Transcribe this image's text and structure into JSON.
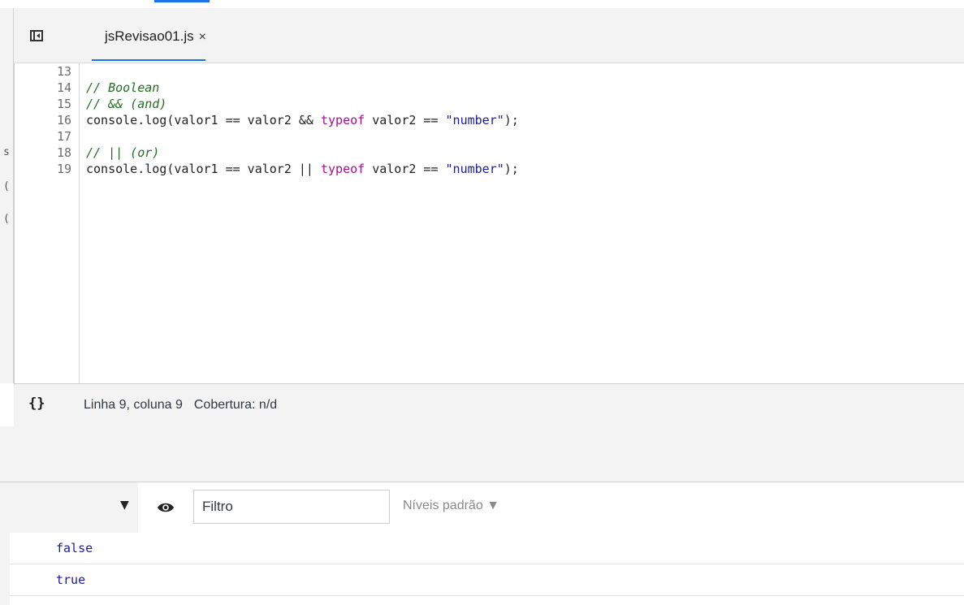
{
  "tab": {
    "filename": "jsRevisao01.js",
    "close_glyph": "×"
  },
  "editor": {
    "lines": [
      {
        "number": "13",
        "segments": []
      },
      {
        "number": "14",
        "segments": [
          {
            "type": "comment",
            "text": "// Boolean"
          }
        ]
      },
      {
        "number": "15",
        "segments": [
          {
            "type": "comment",
            "text": "// && (and)"
          }
        ]
      },
      {
        "number": "16",
        "segments": [
          {
            "type": "plain",
            "text": "console.log(valor1 == valor2 && "
          },
          {
            "type": "keyword",
            "text": "typeof"
          },
          {
            "type": "plain",
            "text": " valor2 == "
          },
          {
            "type": "string",
            "text": "\"number\""
          },
          {
            "type": "plain",
            "text": ");"
          }
        ]
      },
      {
        "number": "17",
        "segments": []
      },
      {
        "number": "18",
        "segments": [
          {
            "type": "comment",
            "text": "// || (or)"
          }
        ]
      },
      {
        "number": "19",
        "segments": [
          {
            "type": "plain",
            "text": "console.log(valor1 == valor2 || "
          },
          {
            "type": "keyword",
            "text": "typeof"
          },
          {
            "type": "plain",
            "text": " valor2 == "
          },
          {
            "type": "string",
            "text": "\"number\""
          },
          {
            "type": "plain",
            "text": ");"
          }
        ]
      }
    ]
  },
  "left_edge_fragments": [
    "s",
    "(",
    "("
  ],
  "status": {
    "pretty_print_glyph": "{}",
    "position": "Linha 9, coluna 9",
    "coverage": "Cobertura: n/d"
  },
  "console": {
    "filter_placeholder": "Filtro",
    "levels_label": "Níveis padrão ▼",
    "context_arrow": "▼",
    "messages": [
      "false",
      "true"
    ]
  },
  "colors": {
    "accent": "#1a73e8",
    "comment": "#236e25",
    "keyword": "#aa0d91",
    "string": "#1a1aa6"
  },
  "icons": {
    "navigator_toggle": "sidebar-toggle-icon",
    "pretty_print": "curly-braces-icon",
    "live_expression": "eye-icon"
  }
}
